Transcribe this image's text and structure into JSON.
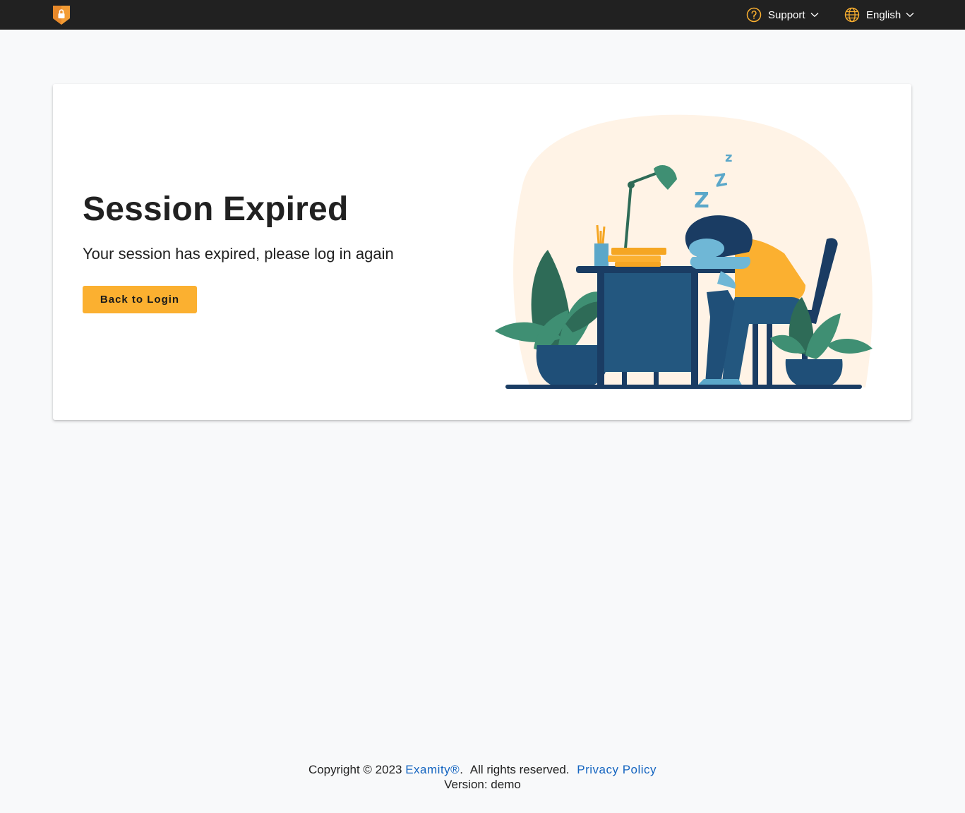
{
  "header": {
    "support_label": "Support",
    "language_label": "English",
    "accent_color": "#fbb030",
    "logo_icon": "shield-lock-icon"
  },
  "main": {
    "title": "Session Expired",
    "message": "Your session has expired, please log in again",
    "button_label": "Back to Login",
    "illustration": "sleeping-at-desk-illustration"
  },
  "footer": {
    "copyright_prefix": "Copyright © 2023",
    "brand_link": "Examity®",
    "rights_text": "All rights reserved.",
    "privacy_link": "Privacy Policy",
    "version": "Version: demo"
  }
}
